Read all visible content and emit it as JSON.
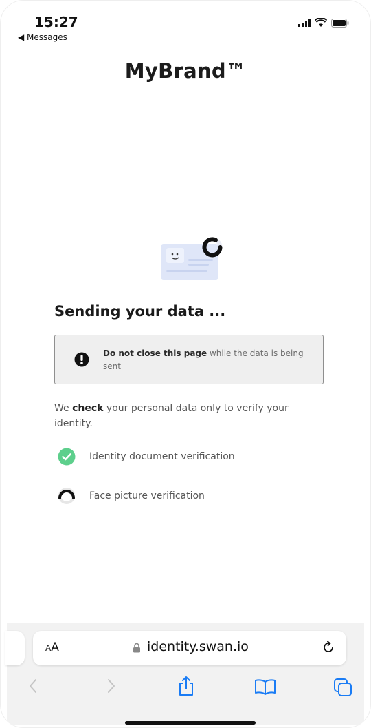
{
  "status_bar": {
    "time": "15:27",
    "back_app": "◀ Messages"
  },
  "brand": "MyBrand™",
  "page": {
    "title": "Sending your data ...",
    "warning": {
      "bold": "Do not close this page",
      "rest": " while the data is being sent"
    },
    "info": {
      "before": "We ",
      "bold": "check",
      "after": " your personal data only to verify your identity."
    },
    "steps": [
      {
        "label": "Identity document verification",
        "status": "done"
      },
      {
        "label": "Face picture verification",
        "status": "in-progress"
      }
    ]
  },
  "browser": {
    "text_size_label_small": "A",
    "text_size_label_large": "A",
    "url": "identity.swan.io",
    "icons": [
      "back-icon",
      "forward-icon",
      "share-icon",
      "bookmarks-icon",
      "tabs-icon",
      "reload-icon",
      "lock-icon"
    ]
  },
  "colors": {
    "success": "#5dcf8c",
    "spinner": "#111111",
    "accent": "#1a7cf5",
    "card": "#dfe6f8"
  }
}
